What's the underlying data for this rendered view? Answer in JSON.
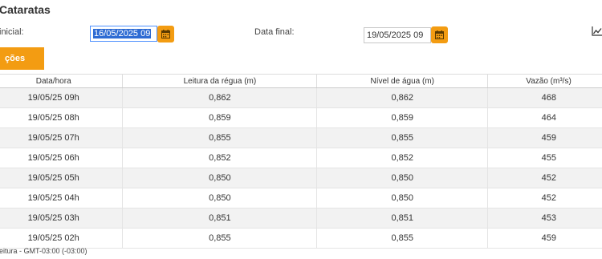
{
  "page": {
    "title": "Cataratas",
    "start_label": "inicial:",
    "start_value": "16/05/2025 09",
    "end_label": "Data final:",
    "end_value": "19/05/2025 09",
    "tab_label": "ções",
    "footnote": "eitura - GMT-03:00 (-03:00)"
  },
  "colors": {
    "accent": "#f39c12",
    "selection": "#2e6bd3",
    "row_alt": "#f2f2f2"
  },
  "icons": {
    "calendar": "calendar-icon",
    "chart": "line-chart-icon"
  },
  "table": {
    "headers": [
      "Data/hora",
      "Leitura da régua (m)",
      "Nível de água (m)",
      "Vazão (m³/s)"
    ],
    "rows": [
      [
        "19/05/25 09h",
        "0,862",
        "0,862",
        "468"
      ],
      [
        "19/05/25 08h",
        "0,859",
        "0,859",
        "464"
      ],
      [
        "19/05/25 07h",
        "0,855",
        "0,855",
        "459"
      ],
      [
        "19/05/25 06h",
        "0,852",
        "0,852",
        "455"
      ],
      [
        "19/05/25 05h",
        "0,850",
        "0,850",
        "452"
      ],
      [
        "19/05/25 04h",
        "0,850",
        "0,850",
        "452"
      ],
      [
        "19/05/25 03h",
        "0,851",
        "0,851",
        "453"
      ],
      [
        "19/05/25 02h",
        "0,855",
        "0,855",
        "459"
      ]
    ]
  }
}
